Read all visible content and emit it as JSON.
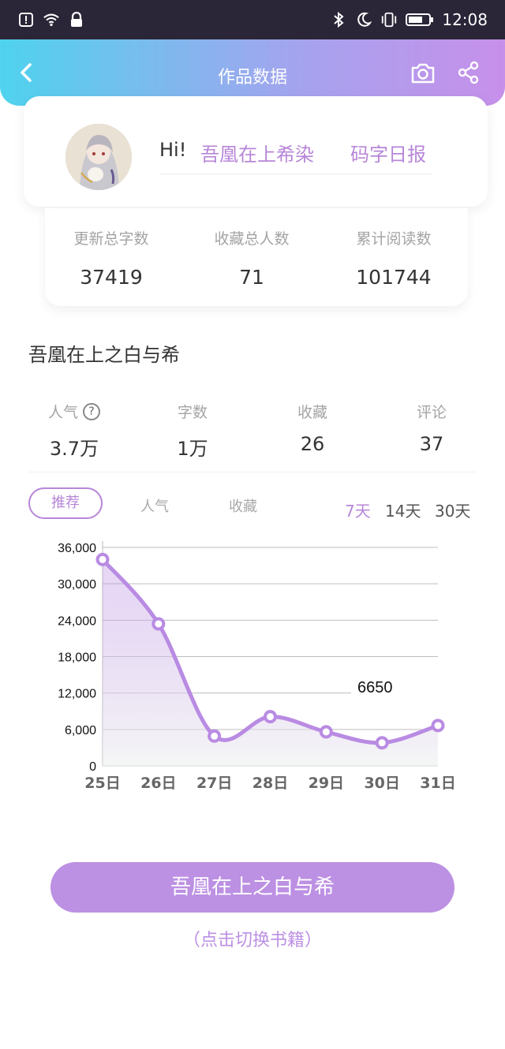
{
  "status_bar": {
    "time": "12:08",
    "left_icons": [
      "alert-icon",
      "wifi-icon",
      "lock-icon"
    ],
    "right_icons": [
      "bluetooth-icon",
      "moon-icon",
      "vibrate-icon",
      "battery-icon"
    ]
  },
  "header": {
    "title": "作品数据",
    "accent_gradient": [
      "#4fd3ee",
      "#a6a3ee",
      "#c790ea"
    ]
  },
  "profile": {
    "greeting": "Hi!",
    "username": "吾凰在上希染",
    "daily_report": "码字日报"
  },
  "summary": [
    {
      "label": "更新总字数",
      "value": "37419"
    },
    {
      "label": "收藏总人数",
      "value": "71"
    },
    {
      "label": "累计阅读数",
      "value": "101744"
    }
  ],
  "book": {
    "title": "吾凰在上之白与希"
  },
  "metrics": [
    {
      "label": "人气",
      "value": "3.7万"
    },
    {
      "label": "字数",
      "value": "1万"
    },
    {
      "label": "收藏",
      "value": "26"
    },
    {
      "label": "评论",
      "value": "37"
    }
  ],
  "tabs": {
    "active": "推荐",
    "others": [
      "人气",
      "收藏"
    ]
  },
  "ranges": [
    "7天",
    "14天",
    "30天"
  ],
  "active_range": "7天",
  "chart_data": {
    "type": "area",
    "categories": [
      "25日",
      "26日",
      "27日",
      "28日",
      "29日",
      "30日",
      "31日"
    ],
    "values": [
      34000,
      23400,
      4900,
      8100,
      5600,
      3800,
      6650
    ],
    "y_ticks": [
      "0",
      "6,000",
      "12,000",
      "18,000",
      "24,000",
      "30,000",
      "36,000"
    ],
    "ylim": [
      0,
      36000
    ],
    "annotation": {
      "label": "6650",
      "category": "31日"
    },
    "grid": true,
    "color": "#b98be3"
  },
  "cta": {
    "label": "吾凰在上之白与希",
    "switch_hint": "（点击切换书籍）"
  }
}
